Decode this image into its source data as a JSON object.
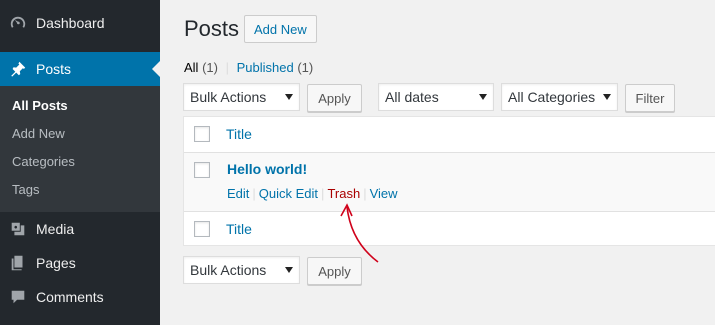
{
  "sidebar": {
    "dashboard": {
      "label": "Dashboard",
      "icon": "dashboard-icon"
    },
    "posts": {
      "label": "Posts",
      "icon": "pin-icon"
    },
    "submenu": [
      "All Posts",
      "Add New",
      "Categories",
      "Tags"
    ],
    "media": {
      "label": "Media",
      "icon": "media-icon"
    },
    "pages": {
      "label": "Pages",
      "icon": "pages-icon"
    },
    "comments": {
      "label": "Comments",
      "icon": "comments-icon"
    }
  },
  "header": {
    "title": "Posts",
    "add_new": "Add New"
  },
  "filters": {
    "all": "All",
    "all_count": "(1)",
    "published": "Published",
    "published_count": "(1)"
  },
  "tablenav_top": {
    "bulk_actions": "Bulk Actions",
    "apply": "Apply",
    "dates": "All dates",
    "categories": "All Categories",
    "filter": "Filter"
  },
  "table": {
    "column_title": "Title",
    "post": {
      "title": "Hello world!",
      "actions": {
        "edit": "Edit",
        "quick_edit": "Quick Edit",
        "trash": "Trash",
        "view": "View"
      }
    }
  },
  "tablenav_bottom": {
    "bulk_actions": "Bulk Actions",
    "apply": "Apply"
  },
  "colors": {
    "sidebar": "#23282d",
    "accent": "#0073aa",
    "trash": "#a00000",
    "annotation": "#d0021b"
  }
}
